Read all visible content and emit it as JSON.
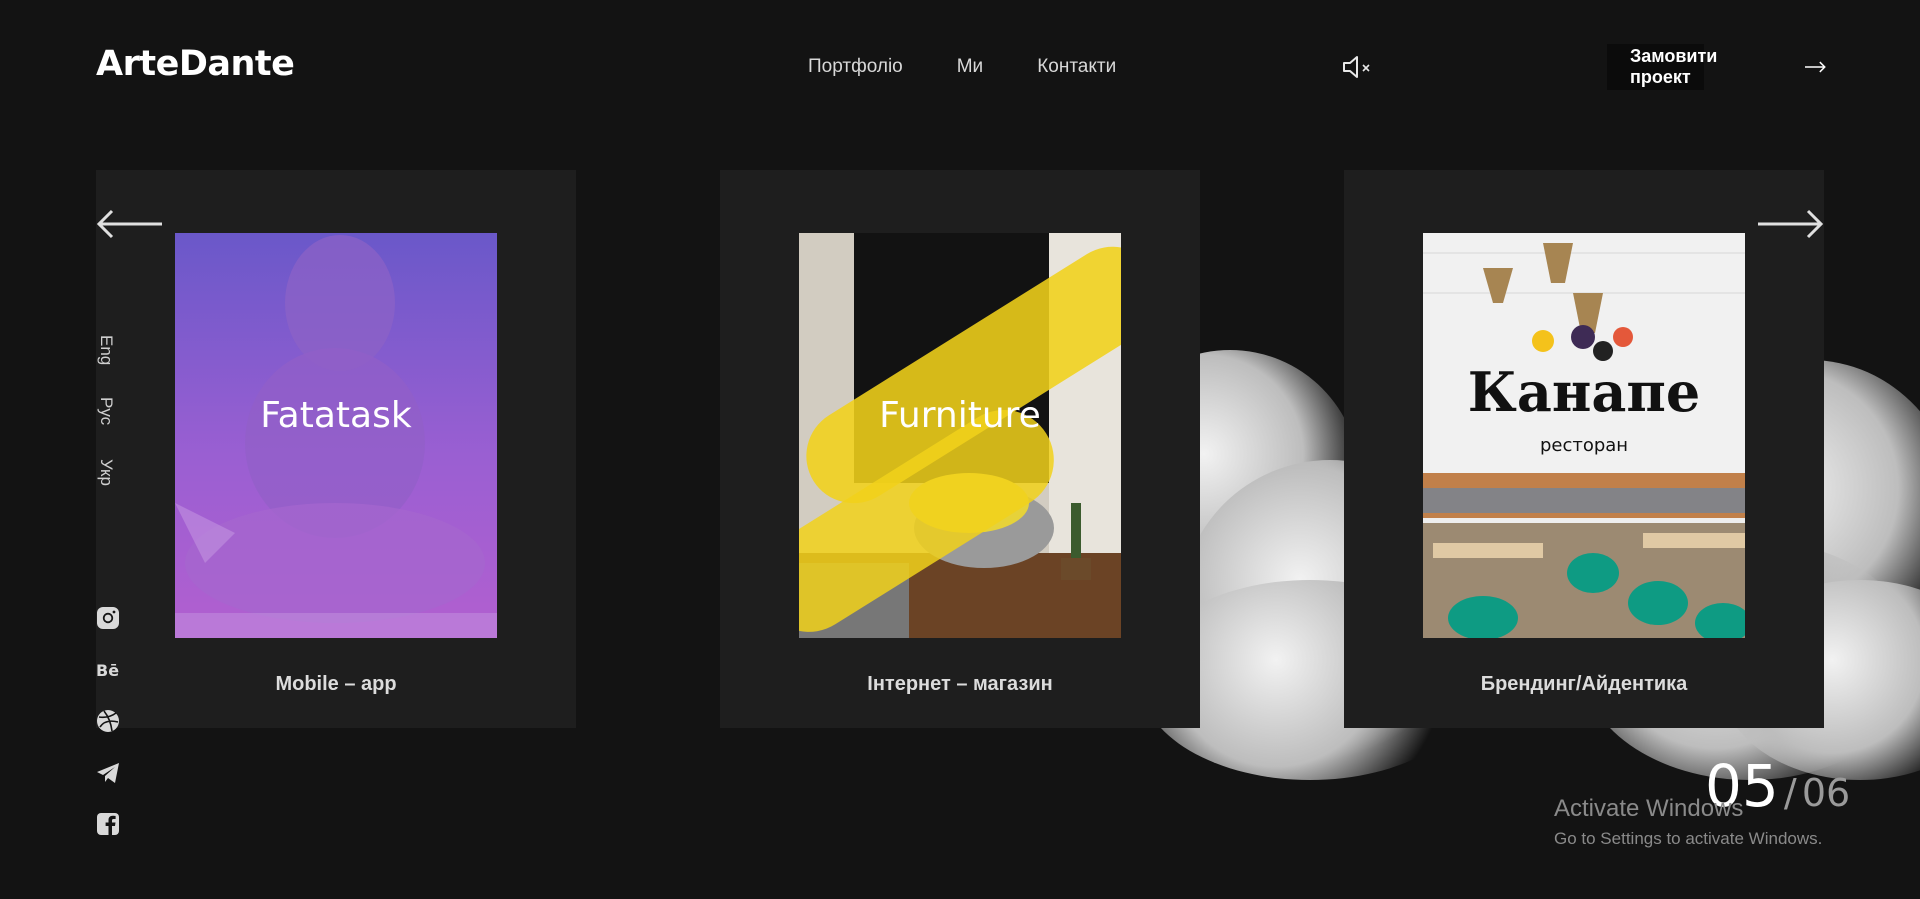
{
  "header": {
    "logo": "ArteDante",
    "nav": [
      "Портфоліо",
      "Ми",
      "Контакти"
    ],
    "order_button": "Замовити проект",
    "sound_icon": "speaker-muted-icon"
  },
  "languages": [
    "Eng",
    "Рус",
    "Укр"
  ],
  "socials": [
    "instagram-icon",
    "behance-icon",
    "dribbble-icon",
    "telegram-icon",
    "facebook-icon"
  ],
  "projects": [
    {
      "title": "Fatatask",
      "caption": "Mobile – app"
    },
    {
      "title": "Furniture",
      "caption": "Інтернет – магазин"
    },
    {
      "title": "Канапе",
      "subtitle": "ресторан",
      "caption": "Брендинг/Айдентика"
    }
  ],
  "pagination": {
    "current": "05",
    "separator": "/",
    "total": "06"
  },
  "watermark": {
    "title": "Activate Windows",
    "subtitle": "Go to Settings to activate Windows."
  },
  "colors": {
    "background": "#131313",
    "card": "#1e1e1e",
    "accent_yellow": "#f2d21b",
    "purple": "#9b5fd6"
  }
}
